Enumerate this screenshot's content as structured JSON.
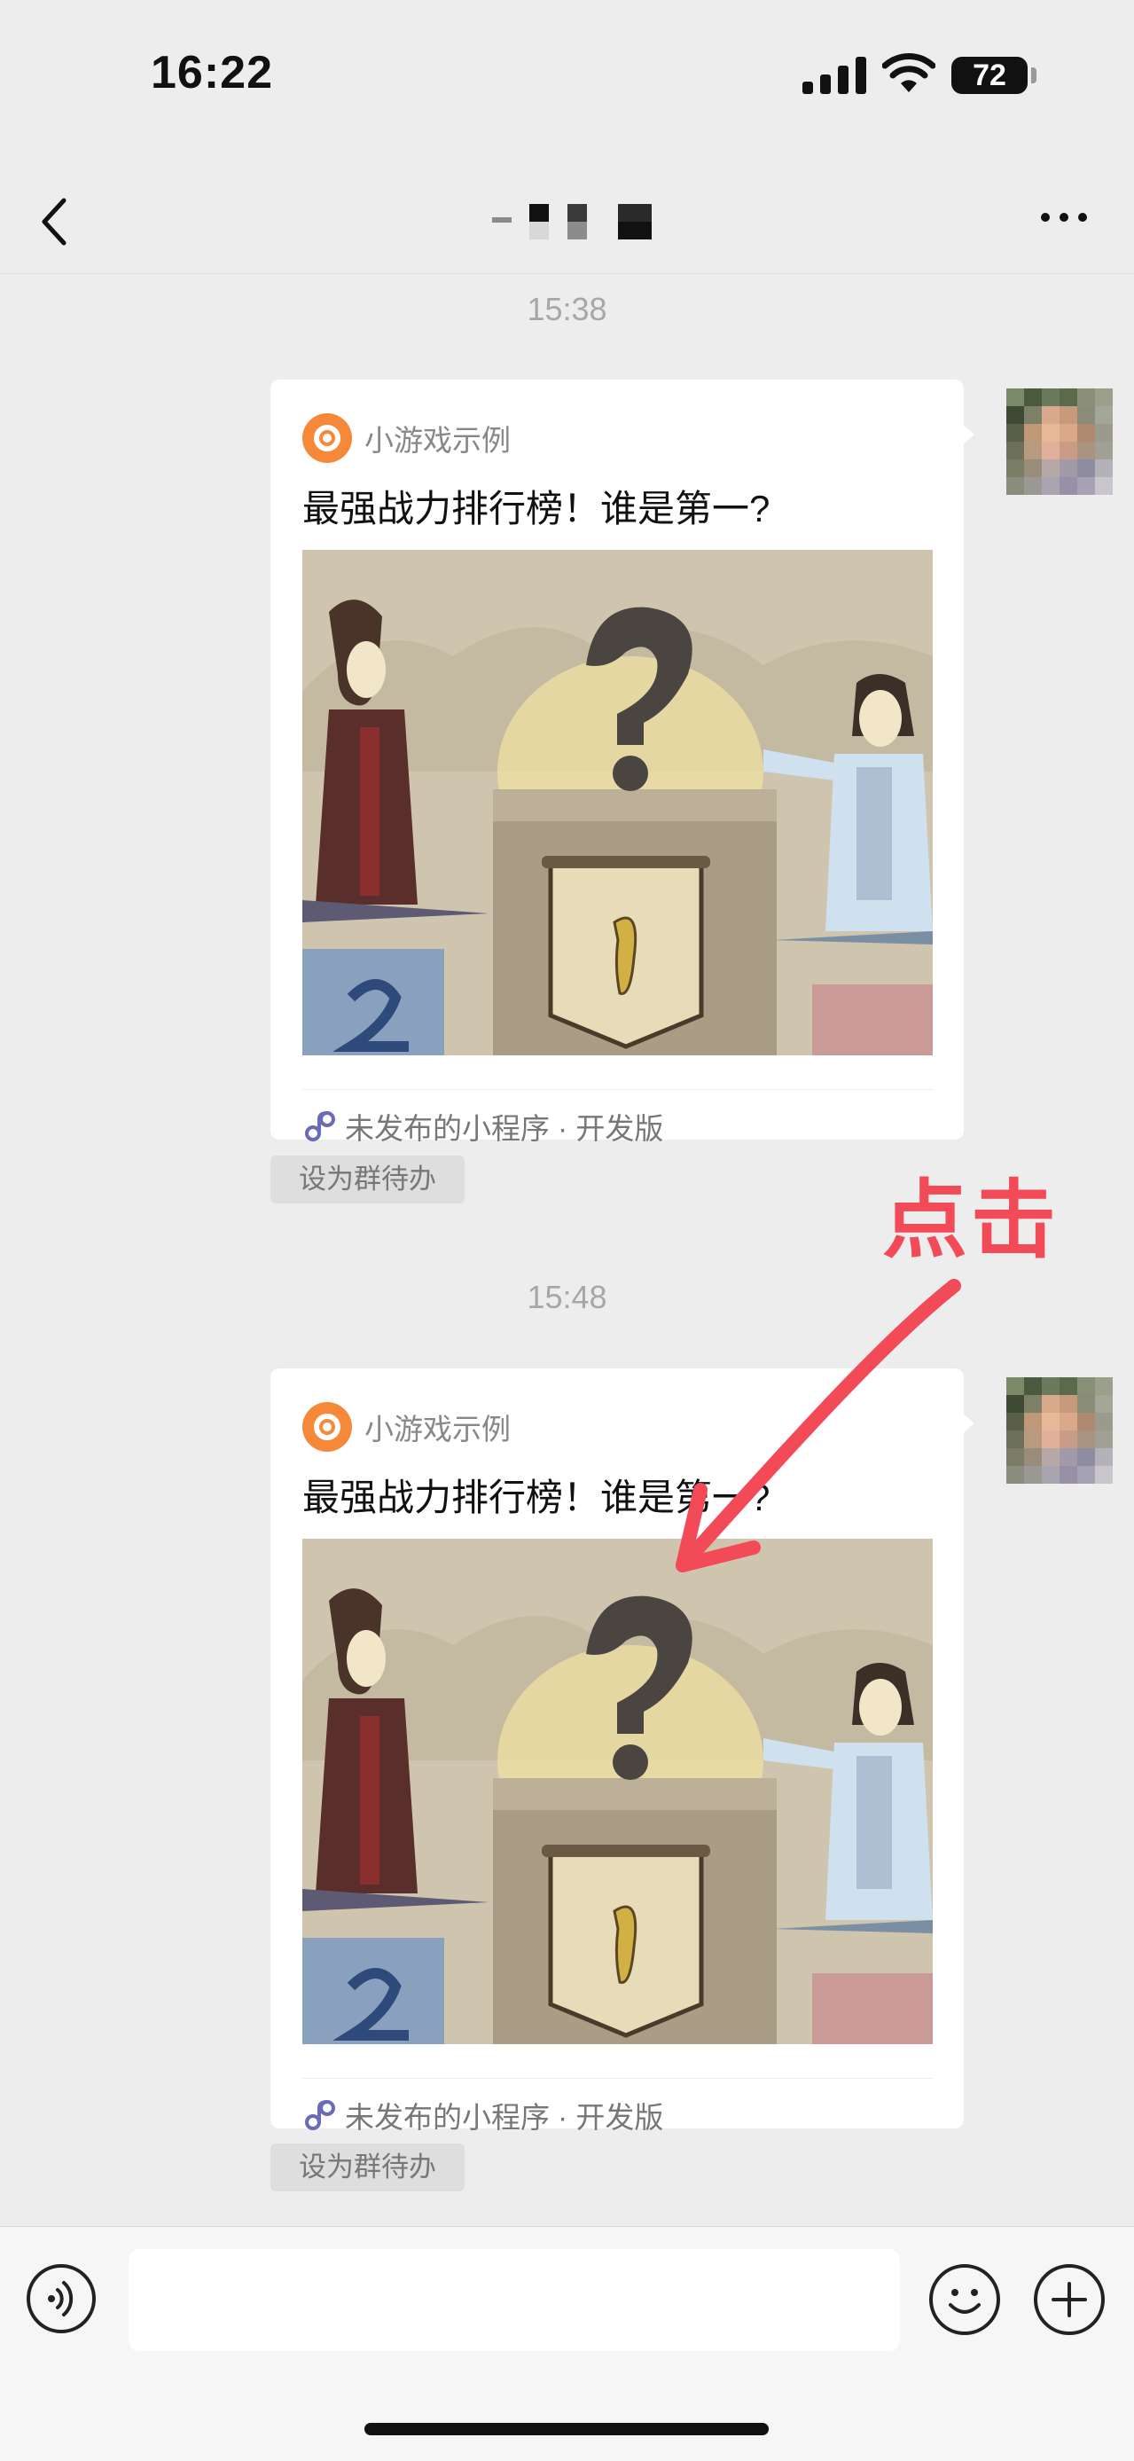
{
  "status_bar": {
    "time": "16:22",
    "battery": "72"
  },
  "nav": {
    "title_pixelated": true
  },
  "messages": [
    {
      "timestamp": "15:38",
      "app_name": "小游戏示例",
      "title": "最强战力排行榜！谁是第一?",
      "footer": "未发布的小程序 · 开发版",
      "todo_label": "设为群待办"
    },
    {
      "timestamp": "15:48",
      "app_name": "小游戏示例",
      "title": "最强战力排行榜！谁是第一?",
      "footer": "未发布的小程序 · 开发版",
      "todo_label": "设为群待办"
    }
  ],
  "annotation": {
    "label": "点击",
    "color": "#f24a57"
  },
  "input_bar": {
    "placeholder": ""
  },
  "icons": {
    "back": "chevron-left-icon",
    "more": "more-dots-icon",
    "app": "mini-game-icon",
    "link": "mini-program-link-icon",
    "voice": "voice-icon",
    "emoji": "emoji-icon",
    "plus": "plus-icon"
  },
  "colors": {
    "background": "#ededed",
    "accent": "#f6883a",
    "annotation": "#f24a57"
  }
}
